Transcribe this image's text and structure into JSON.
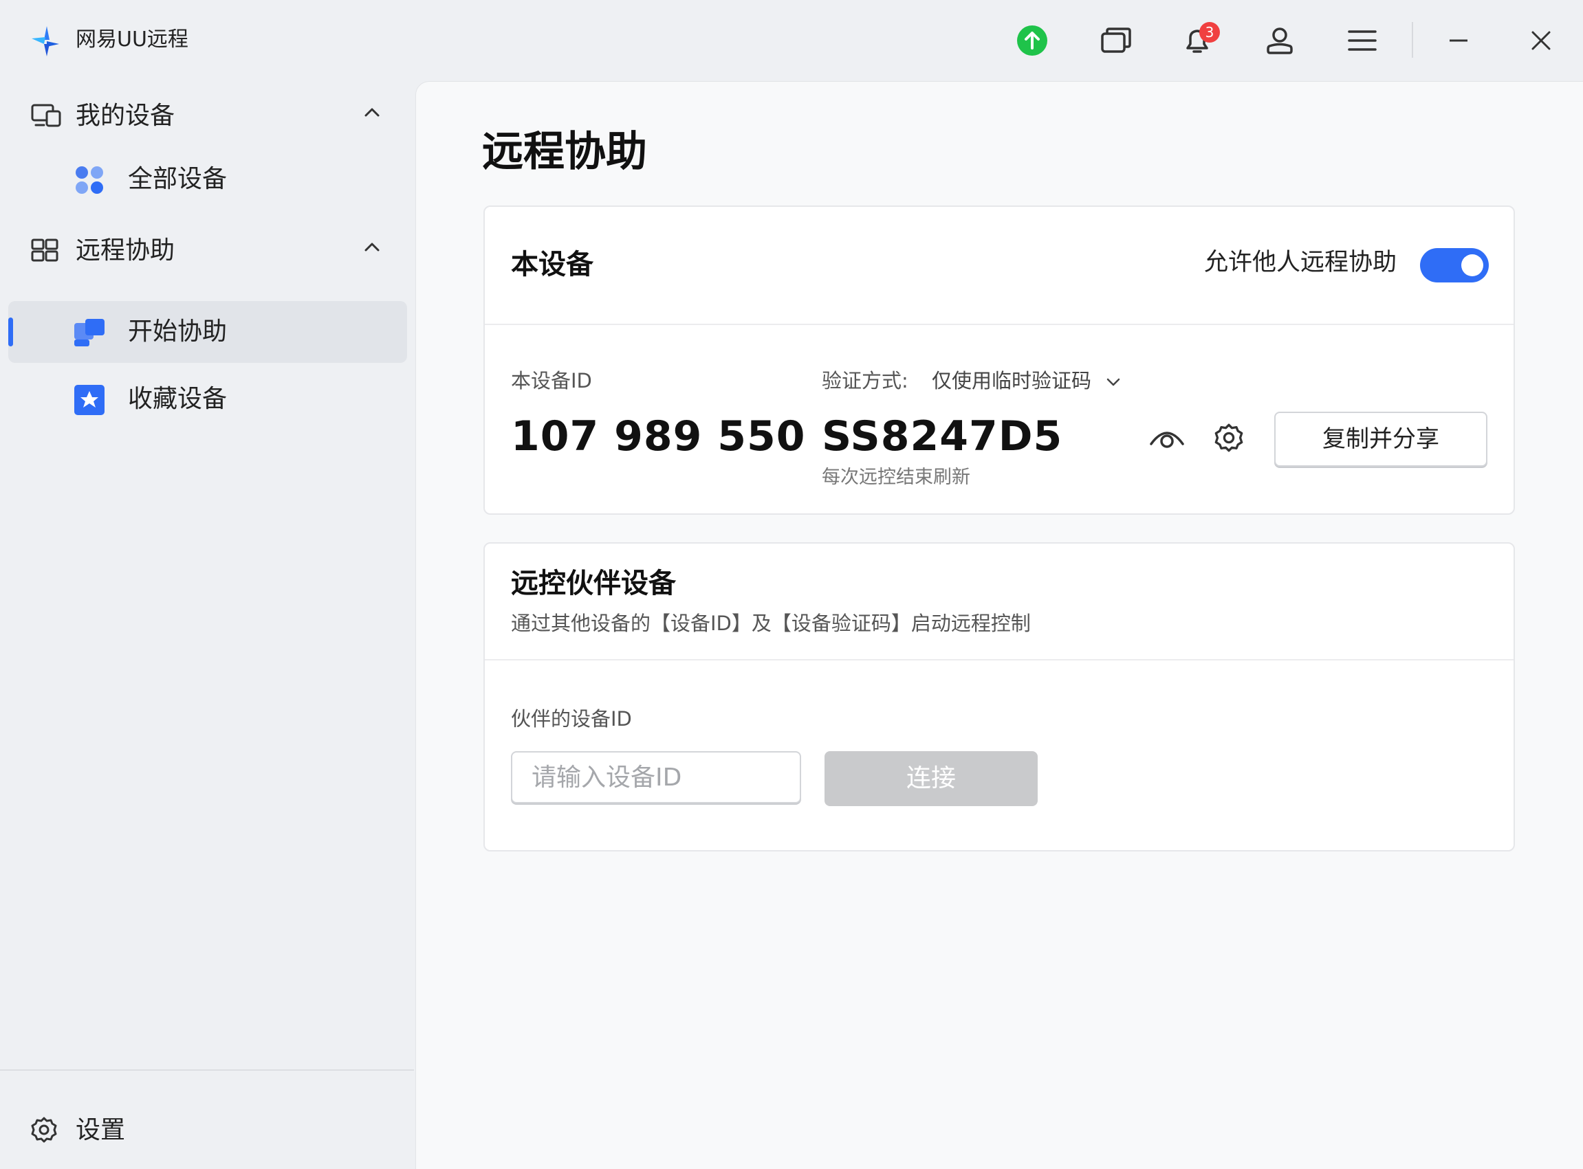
{
  "app": {
    "title": "网易UU远程"
  },
  "titlebar": {
    "upload_icon": "upload-green-icon",
    "multi_window_icon": "multi-window-icon",
    "notification_icon": "bell-icon",
    "notification_count": "3",
    "user_icon": "user-icon",
    "menu_icon": "hamburger-menu-icon",
    "minimize_icon": "minimize-icon",
    "close_icon": "close-icon"
  },
  "sidebar": {
    "groups": [
      {
        "label": "我的设备",
        "items": [
          {
            "label": "全部设备"
          }
        ]
      },
      {
        "label": "远程协助",
        "items": [
          {
            "label": "开始协助"
          },
          {
            "label": "收藏设备"
          }
        ]
      }
    ],
    "settings_label": "设置"
  },
  "main": {
    "title": "远程协助",
    "this_device": {
      "title": "本设备",
      "allow_label": "允许他人远程协助",
      "allow_enabled": true,
      "device_id_label": "本设备ID",
      "device_id": "107 989 550",
      "verify_label": "验证方式:",
      "verify_value": "仅使用临时验证码",
      "verify_code": "SS8247D5",
      "refresh_hint": "每次远控结束刷新",
      "share_button": "复制并分享"
    },
    "partner": {
      "title": "远控伙伴设备",
      "description": "通过其他设备的【设备ID】及【设备验证码】启动远程控制",
      "id_label": "伙伴的设备ID",
      "id_placeholder": "请输入设备ID",
      "connect_button": "连接"
    }
  },
  "colors": {
    "accent": "#2f6df6",
    "badge": "#f04040",
    "upload": "#1fc34a"
  }
}
